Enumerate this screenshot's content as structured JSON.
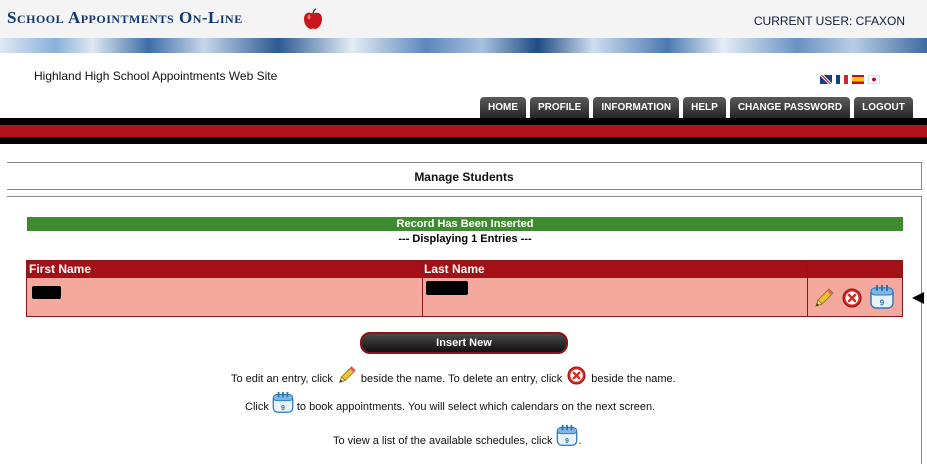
{
  "header": {
    "logo_text": "School Appointments On-Line",
    "current_user": "CURRENT USER: CFAXON",
    "site_name": "Highland High School Appointments Web Site"
  },
  "nav": {
    "home": "HOME",
    "profile": "PROFILE",
    "information": "INFORMATION",
    "help": "HELP",
    "change_password": "CHANGE PASSWORD",
    "logout": "LOGOUT"
  },
  "languages": [
    "uk-flag-icon",
    "france-flag-icon",
    "spain-flag-icon",
    "japan-flag-icon"
  ],
  "page": {
    "title": "Manage Students",
    "banner": "Record Has Been Inserted",
    "displaying": "--- Displaying 1 Entries ---"
  },
  "table": {
    "columns": [
      "First Name",
      "Last Name",
      ""
    ],
    "rows": [
      {
        "first_name": "[redacted]",
        "last_name": "[redacted]",
        "actions": [
          "pencil-icon",
          "delete-icon",
          "calendar-icon"
        ]
      }
    ]
  },
  "insert_button": "Insert New",
  "help": {
    "edit_a": "To edit an entry, click",
    "edit_b": "beside the name. To delete an entry, click",
    "edit_c": "beside the name.",
    "book_a": "Click",
    "book_b": "to book appointments. You will select which calendars on the next screen.",
    "view_a": "To view a list of the available schedules, click",
    "view_b": "."
  },
  "calendar_icon_day": "9",
  "colors": {
    "brand_blue": "#13386e",
    "red_band": "#b01217",
    "banner_green": "#3e8a2e",
    "grid_header": "#a31116",
    "grid_row": "#f5a89e"
  }
}
